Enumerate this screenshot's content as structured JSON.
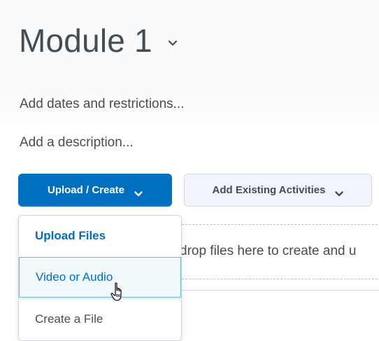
{
  "module": {
    "title": "Module 1"
  },
  "links": {
    "dates": "Add dates and restrictions...",
    "description": "Add a description..."
  },
  "toolbar": {
    "upload_create_label": "Upload / Create",
    "add_existing_label": "Add Existing Activities"
  },
  "menu": {
    "items": [
      {
        "label": "Upload Files"
      },
      {
        "label": "Video or Audio"
      },
      {
        "label": "Create a File"
      }
    ]
  },
  "dropzone": {
    "text": "drop files here to create and u"
  },
  "colors": {
    "accent": "#006fbf",
    "menu_hover_bg": "#f0f8fc",
    "text": "#494c4e"
  },
  "icons": {
    "title_chevron": "chevron-down-icon",
    "cursor": "hand-pointer-cursor"
  }
}
